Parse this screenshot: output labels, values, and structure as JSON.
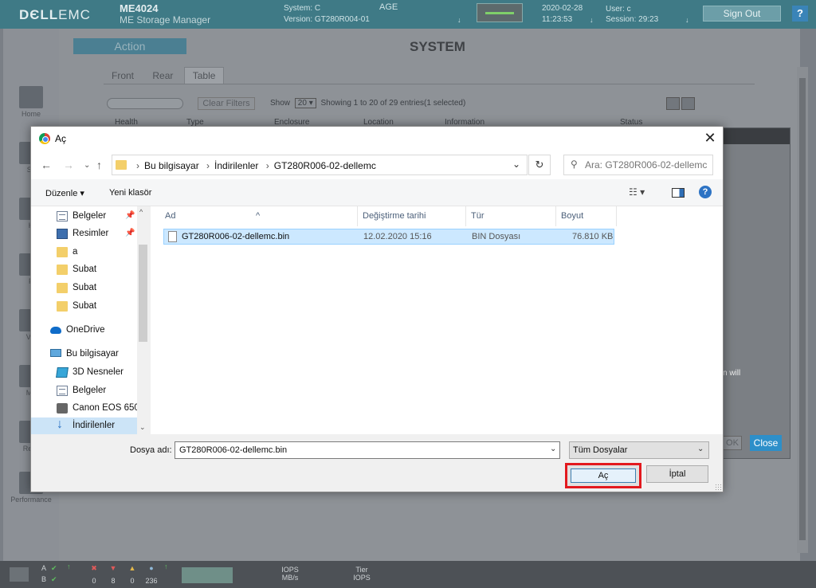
{
  "app": {
    "logo_bold": "DЄLL",
    "logo_light": "EMC",
    "product": "ME4024",
    "product_sub": "ME Storage Manager",
    "system": "System: C",
    "version": "Version: GT280R004-01",
    "age": "AGE",
    "date": "2020-02-28",
    "time": "11:23:53",
    "user": "User: c",
    "session": "Session: 29:23",
    "signout": "Sign Out",
    "help": "?"
  },
  "nav": {
    "items": [
      {
        "label": "Home"
      },
      {
        "label": "Sy"
      },
      {
        "label": "H"
      },
      {
        "label": "P"
      },
      {
        "label": "Vol"
      },
      {
        "label": "Ma"
      },
      {
        "label": "Repli"
      },
      {
        "label": "Performance"
      }
    ]
  },
  "main": {
    "action": "Action",
    "title": "SYSTEM",
    "tabs": [
      {
        "label": "Front"
      },
      {
        "label": "Rear"
      },
      {
        "label": "Table"
      }
    ],
    "clear_filters": "Clear Filters",
    "show_label": "Show",
    "show_value": "20",
    "showing": "Showing 1 to 20 of 29 entries(1 selected)",
    "columns": [
      "Health",
      "Type",
      "Enclosure",
      "Location",
      "Information",
      "Status"
    ]
  },
  "bg_dialog": {
    "ok": "OK",
    "close": "Close",
    "note": "n will"
  },
  "statusbar": {
    "a": "A",
    "b": "B",
    "counts": [
      "0",
      "8",
      "0",
      "236"
    ],
    "iops": "IOPS",
    "mbs": "MB/s",
    "tier": "Tier",
    "tier_iops": "IOPS"
  },
  "dialog": {
    "title": "Aç",
    "close": "✕",
    "breadcrumb": [
      "Bu bilgisayar",
      "İndirilenler",
      "GT280R006-02-dellemc"
    ],
    "search_placeholder": "Ara: GT280R006-02-dellemc",
    "organize": "Düzenle ▾",
    "new_folder": "Yeni klasör",
    "tree": [
      {
        "label": "Belgeler",
        "icon": "document-icon",
        "pinned": true
      },
      {
        "label": "Resimler",
        "icon": "pictures-icon",
        "pinned": true
      },
      {
        "label": "a",
        "icon": "folder-icon",
        "pinned": false
      },
      {
        "label": "Subat",
        "icon": "folder-icon",
        "pinned": false
      },
      {
        "label": "Subat",
        "icon": "folder-icon",
        "pinned": false
      },
      {
        "label": "Subat",
        "icon": "folder-icon",
        "pinned": false
      },
      {
        "label": "OneDrive",
        "icon": "onedrive-icon",
        "pinned": false
      },
      {
        "label": "Bu bilgisayar",
        "icon": "computer-icon",
        "pinned": false
      },
      {
        "label": "3D Nesneler",
        "icon": "3d-objects-icon",
        "pinned": false
      },
      {
        "label": "Belgeler",
        "icon": "document-icon",
        "pinned": false
      },
      {
        "label": "Canon EOS 650D",
        "icon": "camera-icon",
        "pinned": false
      },
      {
        "label": "İndirilenler",
        "icon": "downloads-icon",
        "pinned": false
      }
    ],
    "columns": {
      "name": "Ad",
      "modified": "Değiştirme tarihi",
      "type": "Tür",
      "size": "Boyut"
    },
    "files": [
      {
        "name": "GT280R006-02-dellemc.bin",
        "modified": "12.02.2020 15:16",
        "type": "BIN Dosyası",
        "size": "76.810 KB"
      }
    ],
    "filename_label": "Dosya adı:",
    "filename_value": "GT280R006-02-dellemc.bin",
    "filetype_value": "Tüm Dosyalar",
    "open_label": "Aç",
    "cancel_label": "İptal",
    "highlight_color": "#e3191e"
  }
}
